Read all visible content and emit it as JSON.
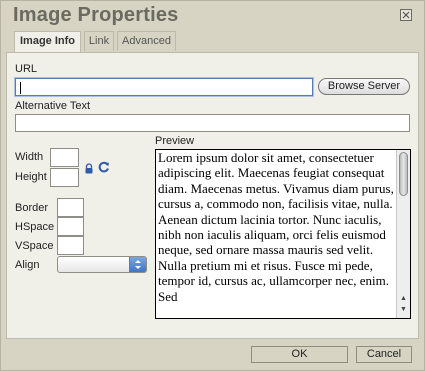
{
  "dialog": {
    "title": "Image Properties",
    "tabs": [
      {
        "label": "Image Info",
        "active": true
      },
      {
        "label": "Link",
        "active": false
      },
      {
        "label": "Advanced",
        "active": false
      }
    ]
  },
  "form": {
    "url_label": "URL",
    "url_value": "",
    "browse_button": "Browse Server",
    "alt_label": "Alternative Text",
    "alt_value": "",
    "width_label": "Width",
    "width_value": "",
    "height_label": "Height",
    "height_value": "",
    "border_label": "Border",
    "border_value": "",
    "hspace_label": "HSpace",
    "hspace_value": "",
    "vspace_label": "VSpace",
    "vspace_value": "",
    "align_label": "Align",
    "align_value": ""
  },
  "preview": {
    "label": "Preview",
    "text": "Lorem ipsum dolor sit amet, consectetuer adipiscing elit. Maecenas feugiat consequat diam. Maecenas metus. Vivamus diam purus, cursus a, commodo non, facilisis vitae, nulla. Aenean dictum lacinia tortor. Nunc iaculis, nibh non iaculis aliquam, orci felis euismod neque, sed ornare massa mauris sed velit. Nulla pretium mi et risus. Fusce mi pede, tempor id, cursus ac, ullamcorper nec, enim. Sed"
  },
  "footer": {
    "ok": "OK",
    "cancel": "Cancel"
  },
  "icons": {
    "close": "close-icon",
    "lock": "lock-icon",
    "reset": "reset-size-icon"
  },
  "colors": {
    "dialog_bg": "#d7d4c4",
    "panel_bg": "#f1f0e8",
    "title_text": "#6b6a60",
    "focus_border": "#5b7bb3"
  }
}
